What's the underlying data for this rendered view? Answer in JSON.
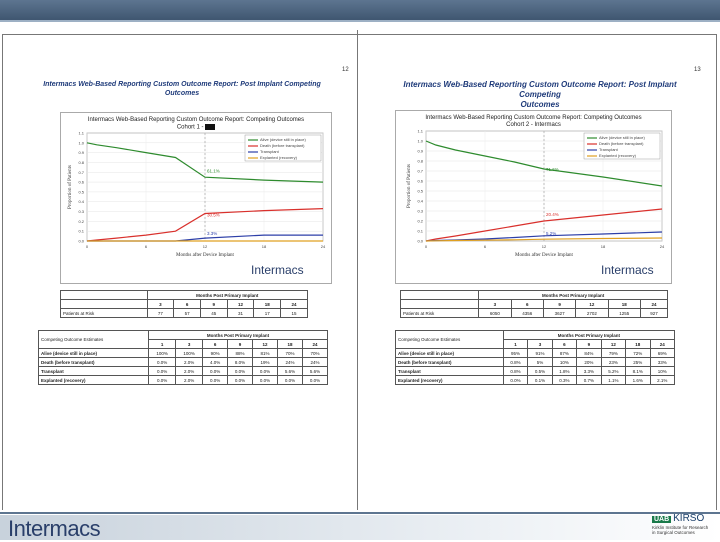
{
  "left": {
    "page_number": "12",
    "title_line1": "Intermacs Web-Based Reporting Custom Outcome Report: Post Implant Competing",
    "title_line2": "Outcomes",
    "chart_title_line1": "Intermacs Web-Based Reporting Custom Outcome Report: Competing Outcomes",
    "chart_title_line2": "Cohort 1 -",
    "legend": [
      "Alive (device still in place)",
      "Death (before transplant)",
      "Transplant",
      "Explanted (recovery)"
    ],
    "ylabel": "Proportion of Patients",
    "xlabel": "Months after Device Implant",
    "labels": {
      "alive": "61.1%",
      "death": "30.5%",
      "transplant": "3.3%"
    },
    "brand": "Intermacs",
    "table1_header": "Months Post Primary Implant",
    "table1_cols": [
      "3",
      "6",
      "9",
      "12",
      "18",
      "24"
    ],
    "table1_row_label": "Patients at Risk",
    "table1_row": [
      "77",
      "57",
      "45",
      "31",
      "17",
      "15"
    ],
    "table2_label": "Competing Outcome Estimates",
    "table2_header": "Months Post Primary Implant",
    "table2_cols": [
      "1",
      "3",
      "6",
      "9",
      "12",
      "18",
      "24"
    ],
    "table2_rows": [
      {
        "label": "Alive (device still in place)",
        "values": [
          "100%",
          "100%",
          "90%",
          "88%",
          "81%",
          "70%",
          "70%"
        ]
      },
      {
        "label": "Death (before transplant)",
        "values": [
          "0.0%",
          "2.0%",
          "4.0%",
          "8.0%",
          "19%",
          "24%",
          "24%"
        ]
      },
      {
        "label": "Transplant",
        "values": [
          "0.0%",
          "2.0%",
          "0.0%",
          "0.0%",
          "0.0%",
          "5.6%",
          "5.6%"
        ]
      },
      {
        "label": "Explanted (recovery)",
        "values": [
          "0.0%",
          "2.0%",
          "0.0%",
          "0.0%",
          "0.0%",
          "0.0%",
          "0.0%"
        ]
      }
    ]
  },
  "right": {
    "page_number": "13",
    "title_line1": "Intermacs Web-Based Reporting Custom Outcome Report: Post Implant Competing",
    "title_line2": "Outcomes",
    "chart_title_line1": "Intermacs Web-Based Reporting Custom Outcome Report: Competing Outcomes",
    "chart_title_line2": "Cohort 2 - Intermacs",
    "legend": [
      "Alive (device still in place)",
      "Death (before transplant)",
      "Transplant",
      "Explanted (recovery)"
    ],
    "ylabel": "Proportion of Patients",
    "xlabel": "Months after Device Implant",
    "labels": {
      "alive": "71.6%",
      "death": "20.4%",
      "transplant": "5.2%"
    },
    "brand": "Intermacs",
    "table1_header": "Months Post Primary Implant",
    "table1_cols": [
      "3",
      "6",
      "9",
      "12",
      "18",
      "24"
    ],
    "table1_row_label": "Patients at Risk",
    "table1_row": [
      "6050",
      "4356",
      "3627",
      "2702",
      "1255",
      "927"
    ],
    "table2_label": "Competing Outcome Estimates",
    "table2_header": "Months Post Primary Implant",
    "table2_cols": [
      "1",
      "3",
      "6",
      "9",
      "12",
      "18",
      "24"
    ],
    "table2_rows": [
      {
        "label": "Alive (device still in place)",
        "values": [
          "95%",
          "91%",
          "87%",
          "84%",
          "79%",
          "72%",
          "69%"
        ]
      },
      {
        "label": "Death (before transplant)",
        "values": [
          "0.8%",
          "5%",
          "10%",
          "20%",
          "23%",
          "25%",
          "33%"
        ]
      },
      {
        "label": "Transplant",
        "values": [
          "0.8%",
          "0.5%",
          "1.8%",
          "3.3%",
          "5.2%",
          "8.1%",
          "10%"
        ]
      },
      {
        "label": "Explanted (recovery)",
        "values": [
          "0.0%",
          "0.1%",
          "0.3%",
          "0.7%",
          "1.1%",
          "1.6%",
          "2.1%"
        ]
      }
    ]
  },
  "footer": {
    "logo": "Intermacs",
    "uab": "UAB",
    "kirso": "KIRSO",
    "kirso_line1": "Kirklin Institute for Research",
    "kirso_line2": "in Surgical Outcomes"
  },
  "colors": {
    "alive": "#2e8b2e",
    "death": "#d9302c",
    "transplant": "#2d3fa8",
    "explanted": "#e0a020"
  },
  "chart_data": [
    {
      "type": "line",
      "x": [
        0,
        1,
        3,
        6,
        9,
        12,
        18,
        24
      ],
      "series": [
        {
          "name": "Alive (device still in place)",
          "values": [
            1.0,
            0.98,
            0.95,
            0.9,
            0.85,
            0.65,
            0.62,
            0.6
          ]
        },
        {
          "name": "Death (before transplant)",
          "values": [
            0.0,
            0.01,
            0.03,
            0.06,
            0.1,
            0.28,
            0.31,
            0.33
          ]
        },
        {
          "name": "Transplant",
          "values": [
            0.0,
            0.0,
            0.0,
            0.0,
            0.0,
            0.03,
            0.06,
            0.06
          ]
        },
        {
          "name": "Explanted (recovery)",
          "values": [
            0.0,
            0.0,
            0.0,
            0.0,
            0.0,
            0.0,
            0.0,
            0.0
          ]
        }
      ],
      "ylim": [
        0,
        1.1
      ],
      "xlim": [
        0,
        24
      ]
    },
    {
      "type": "line",
      "x": [
        0,
        1,
        3,
        6,
        9,
        12,
        18,
        24
      ],
      "series": [
        {
          "name": "Alive (device still in place)",
          "values": [
            1.0,
            0.96,
            0.91,
            0.85,
            0.79,
            0.72,
            0.64,
            0.55
          ]
        },
        {
          "name": "Death (before transplant)",
          "values": [
            0.0,
            0.02,
            0.05,
            0.1,
            0.15,
            0.2,
            0.26,
            0.32
          ]
        },
        {
          "name": "Transplant",
          "values": [
            0.0,
            0.005,
            0.01,
            0.02,
            0.035,
            0.052,
            0.07,
            0.09
          ]
        },
        {
          "name": "Explanted (recovery)",
          "values": [
            0.0,
            0.002,
            0.005,
            0.008,
            0.012,
            0.018,
            0.025,
            0.03
          ]
        }
      ],
      "ylim": [
        0,
        1.1
      ],
      "xlim": [
        0,
        24
      ]
    }
  ]
}
